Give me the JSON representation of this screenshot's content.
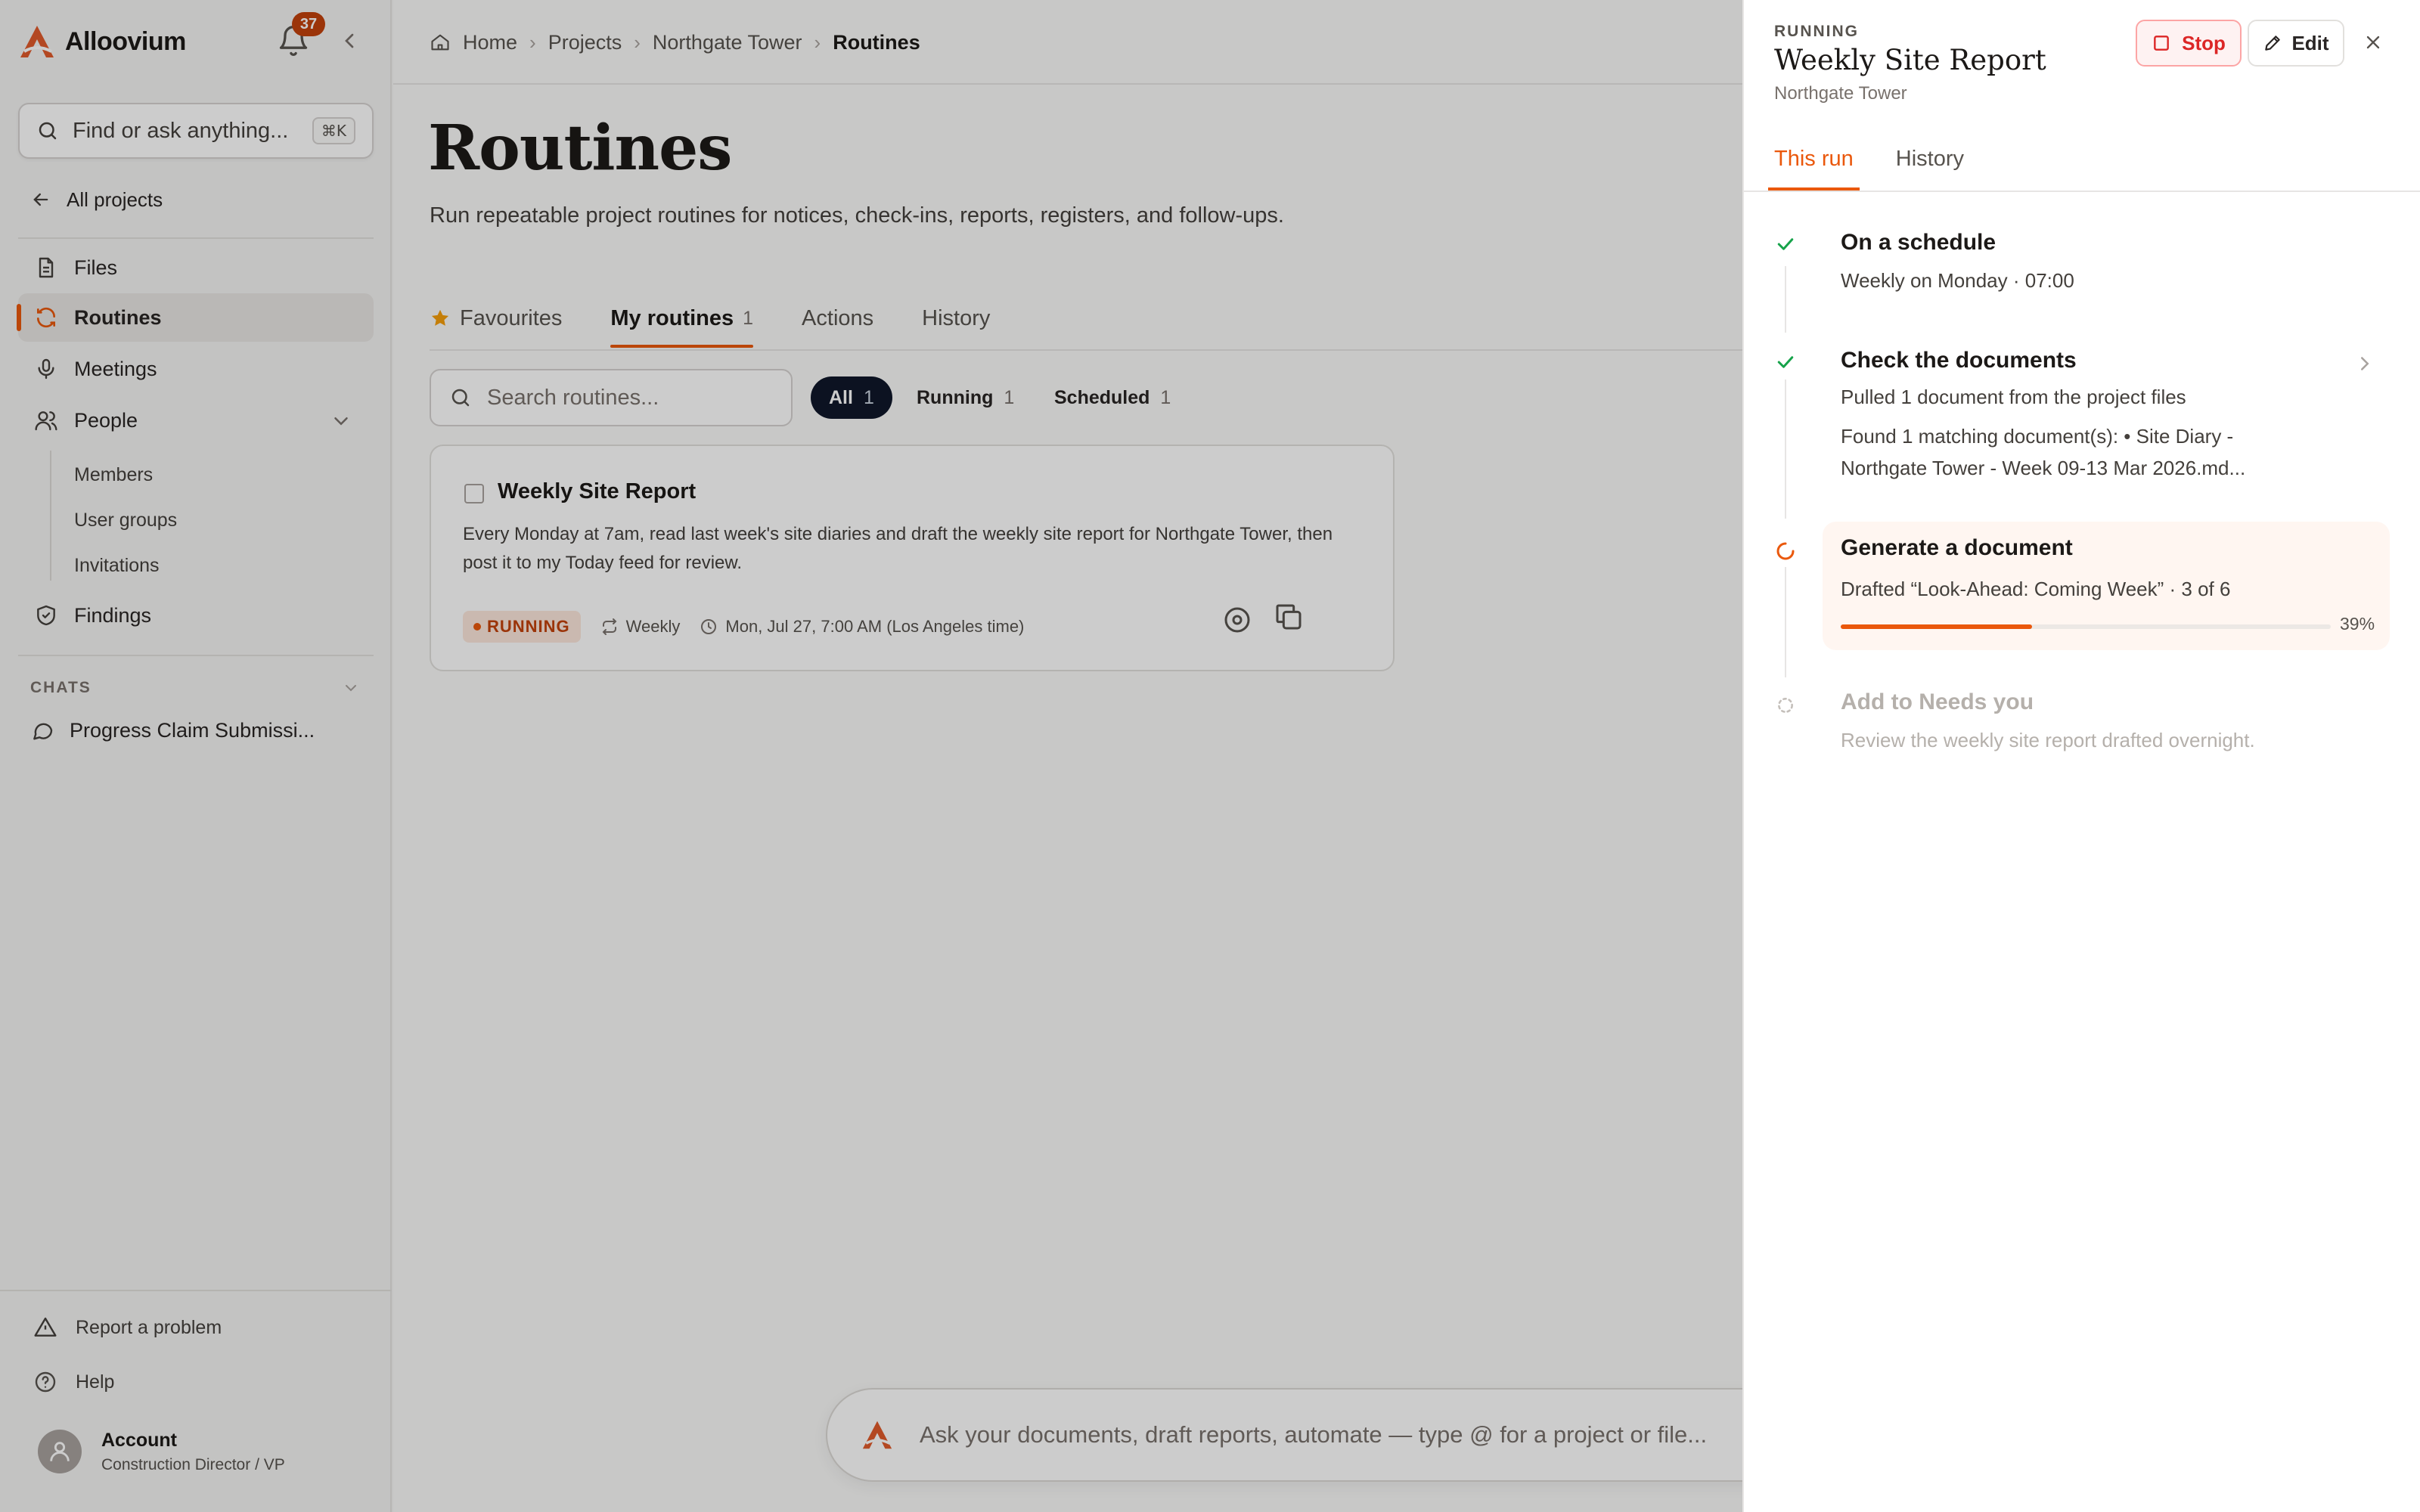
{
  "app": {
    "name": "Alloovium",
    "notification_count": "37"
  },
  "colors": {
    "accent": "#ea580c",
    "brand": "#e05a2b",
    "success": "#16a34a",
    "danger": "#dc2626",
    "dark_chip": "#0f172a"
  },
  "sidebar": {
    "search_placeholder": "Find or ask anything...",
    "search_shortcut": "⌘K",
    "all_projects": "All projects",
    "items": [
      {
        "label": "Files",
        "icon": "file-icon"
      },
      {
        "label": "Routines",
        "icon": "refresh-icon",
        "active": true
      },
      {
        "label": "Meetings",
        "icon": "microphone-icon"
      },
      {
        "label": "People",
        "icon": "users-icon"
      },
      {
        "label": "Findings",
        "icon": "shield-check-icon"
      }
    ],
    "people_sub": [
      "Members",
      "User groups",
      "Invitations"
    ],
    "chats_label": "CHATS",
    "chats": [
      "Progress Claim Submissi..."
    ],
    "footer": {
      "report": "Report a problem",
      "help": "Help"
    },
    "account": {
      "name": "Account",
      "role": "Construction Director / VP"
    }
  },
  "breadcrumb": [
    "Home",
    "Projects",
    "Northgate Tower",
    "Routines"
  ],
  "page": {
    "title": "Routines",
    "description": "Run repeatable project routines for notices, check-ins, reports, registers, and follow-ups."
  },
  "tabs": [
    {
      "label": "Favourites",
      "count": ""
    },
    {
      "label": "My routines",
      "count": "1"
    },
    {
      "label": "Actions",
      "count": ""
    },
    {
      "label": "History",
      "count": ""
    }
  ],
  "filters": {
    "search_placeholder": "Search routines...",
    "chips": [
      {
        "label": "All",
        "count": "1"
      },
      {
        "label": "Running",
        "count": "1"
      },
      {
        "label": "Scheduled",
        "count": "1"
      }
    ]
  },
  "routine_card": {
    "title": "Weekly Site Report",
    "description": "Every Monday at 7am, read last week's site diaries and draft the weekly site report for Northgate Tower, then post it to my Today feed for review.",
    "status": "RUNNING",
    "frequency": "Weekly",
    "next_run": "Mon, Jul 27, 7:00 AM (Los Angeles time)"
  },
  "chat_input": {
    "placeholder": "Ask your documents, draft reports, automate — type @ for a project or file..."
  },
  "drawer": {
    "status": "RUNNING",
    "title": "Weekly Site Report",
    "subtitle": "Northgate Tower",
    "stop_label": "Stop",
    "edit_label": "Edit",
    "tabs": [
      "This run",
      "History"
    ],
    "steps": [
      {
        "title": "On a schedule",
        "lines": [
          "Weekly on Monday · 07:00"
        ],
        "state": "done"
      },
      {
        "title": "Check the documents",
        "lines": [
          "Pulled 1 document from the project files",
          "Found 1 matching document(s): • Site Diary - Northgate Tower - Week 09-13 Mar 2026.md..."
        ],
        "state": "done"
      },
      {
        "title": "Generate a document",
        "lines": [
          "Drafted “Look-Ahead: Coming Week” · 3 of 6"
        ],
        "state": "running",
        "progress": 0.39,
        "progress_label": "39%"
      },
      {
        "title": "Add to Needs you",
        "lines": [
          "Review the weekly site report drafted overnight."
        ],
        "state": "pending"
      }
    ]
  }
}
